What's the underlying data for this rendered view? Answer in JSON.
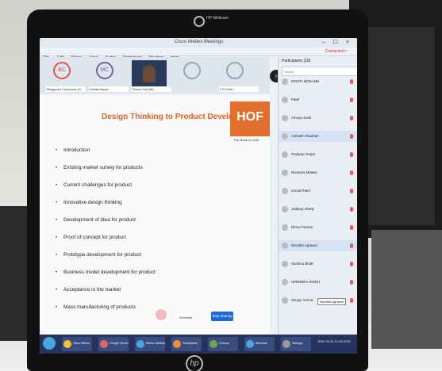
{
  "window": {
    "title": "Cisco Webex Meetings",
    "controls": "–  ☐  ×",
    "status": "Connected •"
  },
  "menu": [
    "File",
    "Edit",
    "Share",
    "View",
    "Audio",
    "Participant",
    "Meeting",
    "Help"
  ],
  "video_tiles": [
    {
      "initials": "BC",
      "name": "Bhagyesh Chanvada (H...",
      "color": "#e05656"
    },
    {
      "initials": "MC",
      "name": "Ankita Nayak",
      "color": "#7a5fa5"
    },
    {
      "initials": "",
      "name": "Shaxe Hall (M)",
      "video": true
    },
    {
      "initials": "",
      "name": "",
      "color": "#8fa6b8"
    },
    {
      "initials": "",
      "name": "LTO ANA...",
      "color": "#8fa6b8"
    }
  ],
  "slide": {
    "title": "Design Thinking to Product Development",
    "logo": "HOF",
    "logo_sub": "The Made in India",
    "bullets": [
      "Introduction",
      "Existing market survey for products",
      "Current challenges for product",
      "Innovative design thinking",
      "Development of idea for product",
      "Proof of concept for product",
      "Prototype development for product",
      "Business model development for product",
      "Acceptance in the market",
      "Mass manufacturing of products"
    ],
    "controls_label": "Annotate",
    "stop_button": "Stop sharing"
  },
  "participants": {
    "header": "Participants (18)",
    "search_placeholder": "Search",
    "items": [
      {
        "name": "KRUPA MOKAME",
        "hl": false
      },
      {
        "name": "Patel",
        "hl": false
      },
      {
        "name": "Ameya Joshi",
        "hl": false
      },
      {
        "name": "Avinash Chauhan",
        "hl": true
      },
      {
        "name": "Pradeep Gupta",
        "hl": false
      },
      {
        "name": "Ravindra Mhatre",
        "hl": false
      },
      {
        "name": "Komal Patel",
        "hl": false
      },
      {
        "name": "Jaideep Shetty",
        "hl": false
      },
      {
        "name": "Dhruv Parmar",
        "hl": false
      },
      {
        "name": "Nivedita Agrawal",
        "hl": true
      },
      {
        "name": "Sushma Bhatt",
        "hl": false
      },
      {
        "name": "UPENDRA SINGH",
        "hl": false
      },
      {
        "name": "Sanjay Verma",
        "hl": false
      }
    ],
    "tooltip": "Nivedita Agrawal"
  },
  "taskbar": {
    "items": [
      "Cisco Webex",
      "Google Chrome",
      "Webex Meeting",
      "Participants",
      "Chrome",
      "Windows",
      "Settings"
    ],
    "tray": "ENG  10:12  12-09-2021"
  },
  "brand": {
    "camera_label": "HP Webcam",
    "monitor_label": "hp"
  }
}
